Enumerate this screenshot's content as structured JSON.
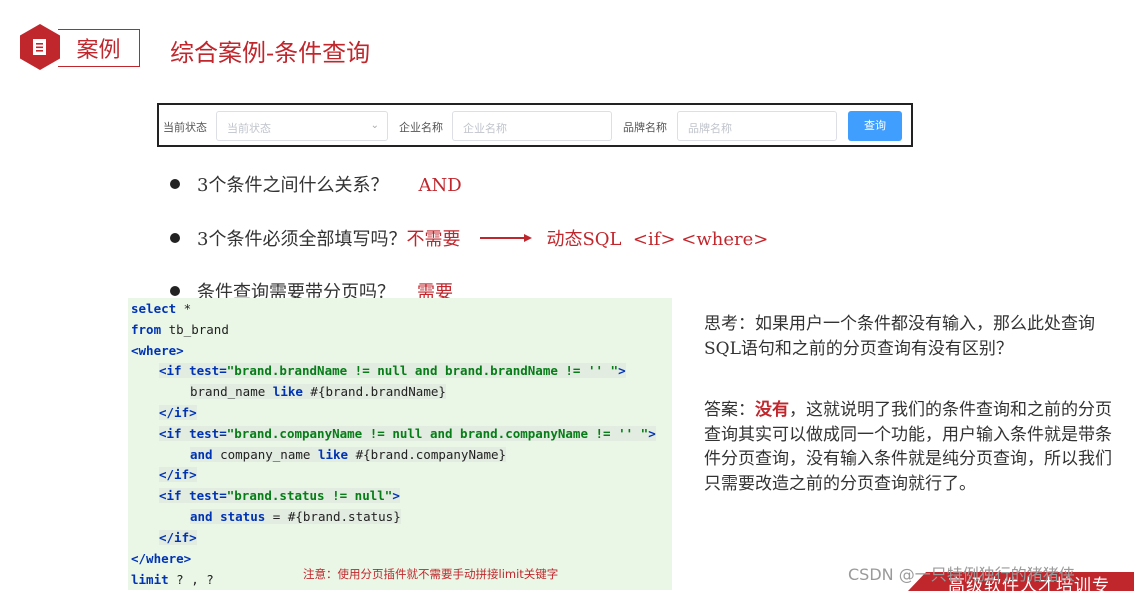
{
  "header": {
    "tag": "案例",
    "title": "综合案例-条件查询"
  },
  "search_form": {
    "status_label": "当前状态",
    "status_placeholder": "当前状态",
    "company_label": "企业名称",
    "company_placeholder": "企业名称",
    "brand_label": "品牌名称",
    "brand_placeholder": "品牌名称",
    "query_button": "查询"
  },
  "bullets": [
    {
      "question": "3个条件之间什么关系？",
      "answer": "AND"
    },
    {
      "question": "3个条件必须全部填写吗？",
      "answer": "不需要",
      "result": "动态SQL  <if> <where>"
    },
    {
      "question": "条件查询需要带分页吗？",
      "answer": "需要"
    }
  ],
  "code": {
    "lines": [
      "select *",
      "from tb_brand",
      "<where>",
      "<if test=\"brand.brandName != null and brand.brandName != '' \">",
      "brand_name like #{brand.brandName}",
      "</if>",
      "<if test=\"brand.companyName != null and brand.companyName != '' \">",
      "and company_name like #{brand.companyName}",
      "</if>",
      "<if test=\"brand.status != null\">",
      "and status = #{brand.status}",
      "</if>",
      "</where>",
      "limit ? , ?"
    ],
    "note": "注意：使用分页插件就不需要手动拼接limit关键字"
  },
  "thinking": {
    "text": "思考：如果用户一个条件都没有输入，那么此处查询SQL语句和之前的分页查询有没有区别？"
  },
  "answer": {
    "prefix": "答案：",
    "keyword": "没有",
    "rest": "，这就说明了我们的条件查询和之前的分页查询其实可以做成同一个功能，用户输入条件就是带条件分页查询，没有输入条件就是纯分页查询，所以我们只需要改造之前的分页查询就行了。"
  },
  "footer": {
    "watermark": "CSDN @一只特例独行的猪猪侠",
    "banner": "高级软件人才培训专"
  },
  "colors": {
    "accent": "#c0272d",
    "button": "#409eff",
    "code_bg": "#eaf7e6"
  }
}
